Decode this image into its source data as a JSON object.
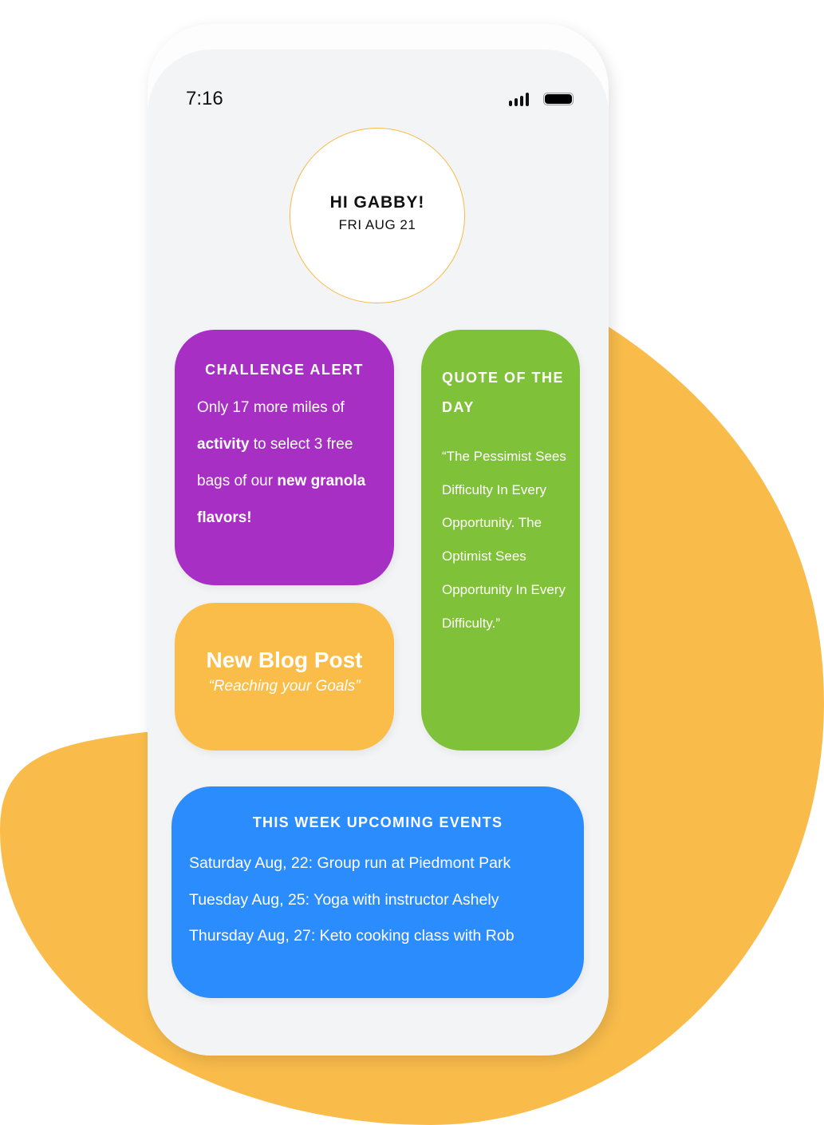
{
  "colors": {
    "blob": "#f9bc4b",
    "purple": "#a72fc4",
    "green": "#80c13a",
    "orange": "#fbbd4a",
    "blue": "#2b8cfd",
    "circle_border": "#f9b944"
  },
  "status_bar": {
    "time": "7:16",
    "signal_icon": "signal-bars-icon",
    "battery_icon": "battery-full-icon"
  },
  "greeting": {
    "title": "HI GABBY!",
    "date": "FRI AUG 21"
  },
  "challenge": {
    "title": "CHALLENGE ALERT",
    "body": [
      {
        "text": "Only 17 more miles of ",
        "bold": false
      },
      {
        "text": "activity",
        "bold": true
      },
      {
        "text": " to select 3 free bags of our ",
        "bold": false
      },
      {
        "text": "new granola flavors!",
        "bold": true
      }
    ]
  },
  "quote": {
    "title": "QUOTE OF THE DAY",
    "text": "“The Pessimist Sees Difficulty In Every Opportunity. The Optimist Sees Opportunity In Every Difficulty.”"
  },
  "blog": {
    "title": "New Blog Post",
    "subtitle": "“Reaching your Goals”"
  },
  "events": {
    "title": "THIS WEEK UPCOMING EVENTS",
    "items": [
      "Saturday Aug, 22: Group run at Piedmont Park",
      "Tuesday Aug, 25: Yoga with instructor Ashely",
      "Thursday Aug, 27: Keto cooking class with Rob"
    ]
  }
}
